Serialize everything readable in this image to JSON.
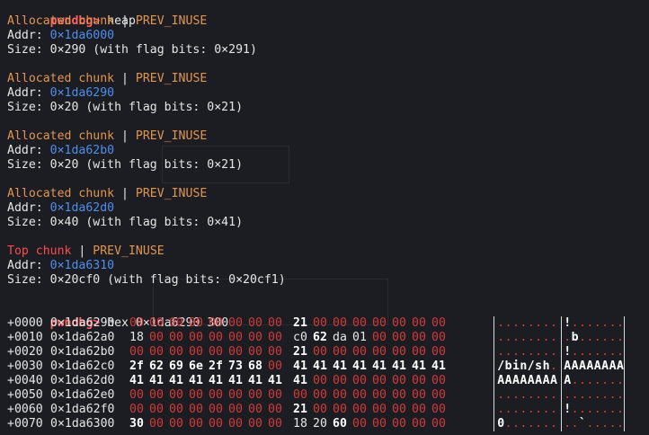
{
  "prompt": "pwndbg>",
  "heap_command": "heap",
  "chunks": [
    {
      "type": "Allocated chunk",
      "sep": " | ",
      "flag": "PREV_INUSE",
      "addr_label": "Addr: ",
      "addr": "0×1da6000",
      "size": "Size: 0×290 (with flag bits: 0×291)"
    },
    {
      "type": "Allocated chunk",
      "sep": " | ",
      "flag": "PREV_INUSE",
      "addr_label": "Addr: ",
      "addr": "0×1da6290",
      "size": "Size: 0×20 (with flag bits: 0×21)"
    },
    {
      "type": "Allocated chunk",
      "sep": " | ",
      "flag": "PREV_INUSE",
      "addr_label": "Addr: ",
      "addr": "0×1da62b0",
      "size": "Size: 0×20 (with flag bits: 0×21)"
    },
    {
      "type": "Allocated chunk",
      "sep": " | ",
      "flag": "PREV_INUSE",
      "addr_label": "Addr: ",
      "addr": "0×1da62d0",
      "size": "Size: 0×40 (with flag bits: 0×41)"
    },
    {
      "type": "Top chunk",
      "sep": " | ",
      "flag": "PREV_INUSE",
      "addr_label": "Addr: ",
      "addr": "0×1da6310",
      "size": "Size: 0×20cf0 (with flag bits: 0×20cf1)"
    }
  ],
  "hex_command": "hex 0×1da6290 300",
  "hex_rows": [
    {
      "off": "+0000",
      "addr": "0×1da6290",
      "bytes": [
        "00",
        "00",
        "00",
        "00",
        "00",
        "00",
        "00",
        "00",
        "21",
        "00",
        "00",
        "00",
        "00",
        "00",
        "00",
        "00"
      ],
      "ascii1": "........",
      "ascii2": "!......."
    },
    {
      "off": "+0010",
      "addr": "0×1da62a0",
      "bytes": [
        "18",
        "00",
        "00",
        "00",
        "00",
        "00",
        "00",
        "00",
        "c0",
        "62",
        "da",
        "01",
        "00",
        "00",
        "00",
        "00"
      ],
      "ascii1": "........",
      "ascii2": ".b......"
    },
    {
      "off": "+0020",
      "addr": "0×1da62b0",
      "bytes": [
        "00",
        "00",
        "00",
        "00",
        "00",
        "00",
        "00",
        "00",
        "21",
        "00",
        "00",
        "00",
        "00",
        "00",
        "00",
        "00"
      ],
      "ascii1": "........",
      "ascii2": "!......."
    },
    {
      "off": "+0030",
      "addr": "0×1da62c0",
      "bytes": [
        "2f",
        "62",
        "69",
        "6e",
        "2f",
        "73",
        "68",
        "00",
        "41",
        "41",
        "41",
        "41",
        "41",
        "41",
        "41",
        "41"
      ],
      "ascii1": "/bin/sh.",
      "ascii2": "AAAAAAAA"
    },
    {
      "off": "+0040",
      "addr": "0×1da62d0",
      "bytes": [
        "41",
        "41",
        "41",
        "41",
        "41",
        "41",
        "41",
        "41",
        "41",
        "00",
        "00",
        "00",
        "00",
        "00",
        "00",
        "00"
      ],
      "ascii1": "AAAAAAAA",
      "ascii2": "A......."
    },
    {
      "off": "+0050",
      "addr": "0×1da62e0",
      "bytes": [
        "00",
        "00",
        "00",
        "00",
        "00",
        "00",
        "00",
        "00",
        "00",
        "00",
        "00",
        "00",
        "00",
        "00",
        "00",
        "00"
      ],
      "ascii1": "........",
      "ascii2": "........"
    },
    {
      "off": "+0060",
      "addr": "0×1da62f0",
      "bytes": [
        "00",
        "00",
        "00",
        "00",
        "00",
        "00",
        "00",
        "00",
        "21",
        "00",
        "00",
        "00",
        "00",
        "00",
        "00",
        "00"
      ],
      "ascii1": "........",
      "ascii2": "!......."
    },
    {
      "off": "+0070",
      "addr": "0×1da6300",
      "bytes": [
        "30",
        "00",
        "00",
        "00",
        "00",
        "00",
        "00",
        "00",
        "18",
        "20",
        "60",
        "00",
        "00",
        "00",
        "00",
        "00"
      ],
      "ascii1": "0.......",
      "ascii2": "..`....."
    }
  ],
  "colors": {
    "background": "#1c1d23",
    "prompt": "#ff5f5f",
    "chunk_type": "#e2954c",
    "top_chunk": "#ff4a4a",
    "address": "#4d8ef0",
    "zero_byte": "#d23a36",
    "text": "#e6e6e6"
  }
}
